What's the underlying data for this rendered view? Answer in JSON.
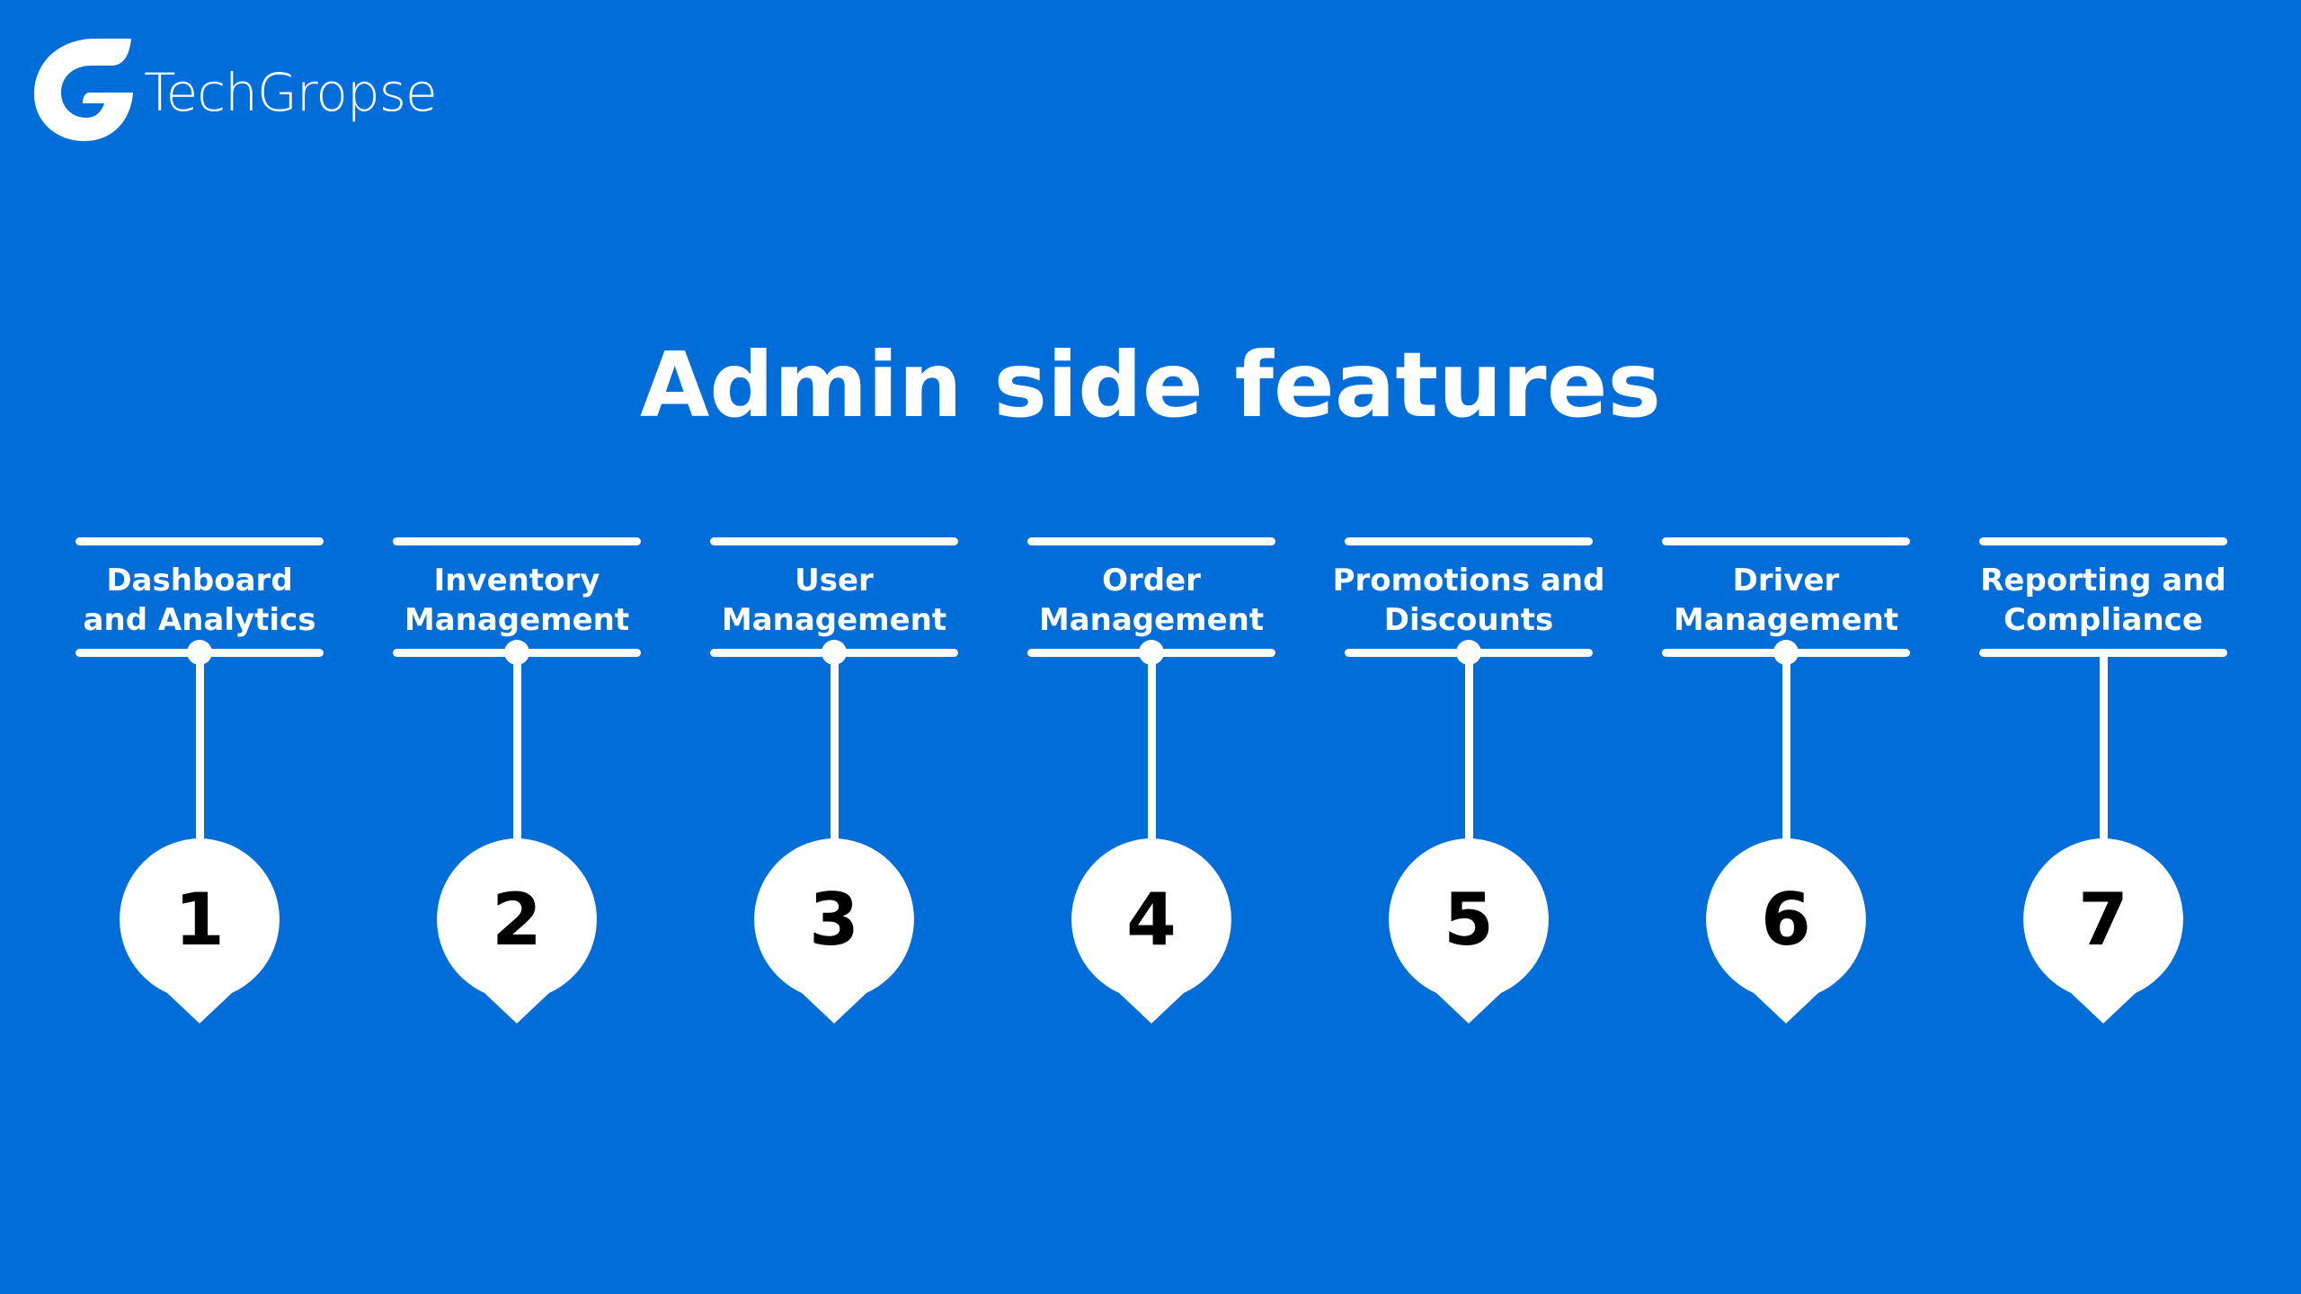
{
  "brand": {
    "name": "TechGropse",
    "logo_icon": "g-logo-icon"
  },
  "colors": {
    "background": "#006DD9",
    "foreground": "#FFFFFF",
    "number": "#000000"
  },
  "title": "Admin side features",
  "features": [
    {
      "number": "1",
      "label": "Dashboard and Analytics",
      "line1": "Dashboard",
      "line2": "and Analytics",
      "has_dot": true
    },
    {
      "number": "2",
      "label": "Inventory Management",
      "line1": "Inventory",
      "line2": "Management",
      "has_dot": true
    },
    {
      "number": "3",
      "label": "User Management",
      "line1": "User",
      "line2": "Management",
      "has_dot": true
    },
    {
      "number": "4",
      "label": "Order Management",
      "line1": "Order",
      "line2": "Management",
      "has_dot": true
    },
    {
      "number": "5",
      "label": "Promotions and Discounts",
      "line1": "Promotions and",
      "line2": "Discounts",
      "has_dot": true
    },
    {
      "number": "6",
      "label": "Driver Management",
      "line1": "Driver",
      "line2": "Management",
      "has_dot": true
    },
    {
      "number": "7",
      "label": "Reporting and Compliance",
      "line1": "Reporting and",
      "line2": "Compliance",
      "has_dot": false
    }
  ]
}
